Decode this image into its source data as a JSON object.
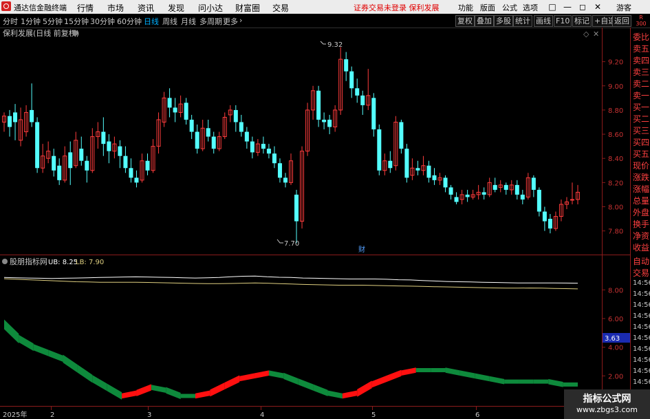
{
  "app": {
    "name": "通达信金融终端",
    "menu": [
      "行情",
      "市场",
      "资讯",
      "发现",
      "问小达",
      "财富圈",
      "交易"
    ],
    "notice": "证券交易未登录  保利发展",
    "right_menu": [
      "功能",
      "版面",
      "公式",
      "选项"
    ],
    "window_buttons": [
      "□",
      "—",
      "◻",
      "✕"
    ],
    "user": "游客"
  },
  "periods": [
    "分时",
    "1分钟",
    "5分钟",
    "15分钟",
    "30分钟",
    "60分钟",
    "日线",
    "周线",
    "月线",
    "多周期",
    "更多"
  ],
  "active_period": "日线",
  "toolbar_right": [
    "复权",
    "叠加",
    "多股",
    "统计",
    "画线",
    "F10",
    "标记",
    "+自选",
    "返回"
  ],
  "chart_title": "保利发展(日线 前复权)",
  "corner_badge": {
    "top": "R",
    "bottom": "300"
  },
  "price_axis": [
    "9.20",
    "9.00",
    "8.80",
    "8.60",
    "8.40",
    "8.20",
    "8.00",
    "7.80"
  ],
  "annotations": {
    "high": "9.32",
    "low": "7.70",
    "event": "财"
  },
  "indicator": {
    "name": "股朋指标网",
    "ub_label": "UB: 8.25",
    "lb_label": "LB: 7.90",
    "axis": [
      "8.00",
      "6.00",
      "4.00",
      "2.00"
    ],
    "current_value": "3.63"
  },
  "x_axis": [
    "2025年",
    "2",
    "3",
    "4",
    "5",
    "6"
  ],
  "side_panel": {
    "top_items": [
      "委比",
      "卖五",
      "卖四",
      "卖三",
      "卖二",
      "卖一",
      "买一",
      "买二",
      "买三",
      "买四",
      "买五",
      "现价",
      "涨跌",
      "涨幅",
      "总量",
      "外盘",
      "换手",
      "净资",
      "收益"
    ],
    "mid_items": [
      "自动",
      "交易"
    ],
    "times": [
      "14:56",
      "14:56",
      "14:56",
      "14:56",
      "14:56",
      "14:56",
      "14:56",
      "14:56",
      "14:56",
      "14:56",
      "14:56",
      "14:56",
      "14:56"
    ]
  },
  "watermark": {
    "line1": "指标公式网",
    "line2": "www.zbgs3.com"
  },
  "colors": {
    "up": "#ff3c3c",
    "down": "#54ffff",
    "ub": "#ffffff",
    "lb": "#e0d080",
    "osc_up": "#ff1010",
    "osc_down": "#0e8a3c"
  },
  "chart_data": {
    "type": "candlestick",
    "y_range": [
      7.65,
      9.38
    ],
    "candles": [
      [
        8.7,
        8.75,
        8.78,
        8.62
      ],
      [
        8.75,
        8.66,
        8.8,
        8.58
      ],
      [
        8.78,
        8.7,
        8.85,
        8.55
      ],
      [
        8.55,
        8.72,
        8.82,
        8.5
      ],
      [
        8.62,
        8.78,
        8.84,
        8.58
      ],
      [
        8.8,
        8.7,
        9.02,
        8.66
      ],
      [
        8.7,
        8.32,
        8.74,
        8.28
      ],
      [
        8.32,
        8.42,
        8.52,
        8.28
      ],
      [
        8.4,
        8.46,
        8.54,
        8.36
      ],
      [
        8.42,
        8.3,
        8.48,
        8.25
      ],
      [
        8.34,
        8.22,
        8.4,
        8.18
      ],
      [
        8.22,
        8.42,
        8.5,
        8.2
      ],
      [
        8.45,
        8.32,
        8.54,
        8.18
      ],
      [
        8.34,
        8.55,
        8.62,
        8.32
      ],
      [
        8.48,
        8.38,
        8.58,
        8.34
      ],
      [
        8.38,
        8.3,
        8.42,
        8.2
      ],
      [
        8.3,
        8.58,
        8.65,
        8.28
      ],
      [
        8.58,
        8.62,
        8.7,
        8.48
      ],
      [
        8.62,
        8.52,
        8.74,
        8.42
      ],
      [
        8.54,
        8.46,
        8.6,
        8.36
      ],
      [
        8.46,
        8.52,
        8.58,
        8.4
      ],
      [
        8.5,
        8.42,
        8.55,
        8.32
      ],
      [
        8.42,
        8.32,
        8.5,
        8.28
      ],
      [
        8.32,
        8.24,
        8.4,
        8.2
      ],
      [
        8.24,
        8.2,
        8.3,
        8.16
      ],
      [
        8.22,
        8.38,
        8.44,
        8.2
      ],
      [
        8.38,
        8.3,
        8.44,
        8.26
      ],
      [
        8.3,
        8.5,
        8.56,
        8.28
      ],
      [
        8.5,
        8.72,
        8.78,
        8.44
      ],
      [
        8.7,
        8.9,
        8.95,
        8.66
      ],
      [
        8.9,
        8.82,
        8.98,
        8.74
      ],
      [
        8.82,
        8.78,
        8.9,
        8.7
      ],
      [
        8.78,
        8.85,
        8.92,
        8.74
      ],
      [
        8.86,
        8.72,
        8.9,
        8.68
      ],
      [
        8.72,
        8.62,
        8.76,
        8.56
      ],
      [
        8.62,
        8.48,
        8.68,
        8.44
      ],
      [
        8.48,
        8.65,
        8.72,
        8.46
      ],
      [
        8.65,
        8.58,
        8.72,
        8.54
      ],
      [
        8.58,
        8.48,
        8.62,
        8.44
      ],
      [
        8.48,
        8.58,
        8.62,
        8.46
      ],
      [
        8.58,
        8.74,
        8.78,
        8.56
      ],
      [
        8.76,
        8.8,
        8.84,
        8.7
      ],
      [
        8.8,
        8.7,
        8.84,
        8.62
      ],
      [
        8.7,
        8.62,
        8.76,
        8.58
      ],
      [
        8.62,
        8.54,
        8.66,
        8.48
      ],
      [
        8.54,
        8.45,
        8.58,
        8.4
      ],
      [
        8.45,
        8.52,
        8.56,
        8.42
      ],
      [
        8.52,
        8.48,
        8.58,
        8.44
      ],
      [
        8.48,
        8.44,
        8.52,
        8.4
      ],
      [
        8.44,
        8.36,
        8.5,
        8.32
      ],
      [
        8.36,
        8.24,
        8.4,
        8.2
      ],
      [
        8.24,
        8.2,
        8.28,
        8.16
      ],
      [
        8.2,
        8.38,
        8.44,
        8.18
      ],
      [
        8.1,
        7.88,
        8.14,
        7.7
      ],
      [
        7.88,
        8.46,
        8.5,
        7.82
      ],
      [
        8.46,
        8.8,
        8.86,
        8.42
      ],
      [
        8.8,
        8.96,
        9.0,
        8.72
      ],
      [
        8.96,
        8.72,
        9.0,
        8.66
      ],
      [
        8.72,
        8.7,
        8.78,
        8.64
      ],
      [
        8.72,
        8.66,
        8.76,
        8.6
      ],
      [
        8.66,
        8.8,
        8.84,
        8.62
      ],
      [
        8.8,
        9.22,
        9.32,
        8.76
      ],
      [
        9.22,
        9.12,
        9.28,
        9.04
      ],
      [
        9.12,
        8.98,
        9.16,
        8.9
      ],
      [
        8.98,
        8.92,
        9.06,
        8.86
      ],
      [
        8.92,
        8.84,
        8.96,
        8.76
      ],
      [
        8.84,
        8.92,
        9.14,
        8.8
      ],
      [
        8.9,
        8.64,
        8.94,
        8.58
      ],
      [
        8.64,
        8.3,
        8.68,
        8.26
      ],
      [
        8.3,
        8.38,
        8.44,
        8.26
      ],
      [
        8.38,
        8.32,
        8.46,
        8.28
      ],
      [
        8.34,
        8.7,
        8.75,
        8.3
      ],
      [
        8.7,
        8.48,
        8.72,
        8.44
      ],
      [
        8.48,
        8.24,
        8.52,
        8.2
      ],
      [
        8.26,
        8.32,
        8.4,
        8.22
      ],
      [
        8.32,
        8.3,
        8.38,
        8.26
      ],
      [
        8.3,
        8.34,
        8.42,
        8.26
      ],
      [
        8.34,
        8.24,
        8.38,
        8.2
      ],
      [
        8.26,
        8.22,
        8.32,
        8.18
      ],
      [
        8.22,
        8.24,
        8.28,
        8.18
      ],
      [
        8.24,
        8.16,
        8.26,
        8.12
      ],
      [
        8.16,
        8.1,
        8.18,
        8.06
      ],
      [
        8.08,
        8.04,
        8.12,
        8.02
      ],
      [
        8.06,
        8.1,
        8.14,
        8.02
      ],
      [
        8.1,
        8.08,
        8.14,
        8.04
      ],
      [
        8.08,
        8.1,
        8.14,
        8.06
      ],
      [
        8.1,
        8.12,
        8.18,
        8.06
      ],
      [
        8.12,
        8.1,
        8.16,
        8.06
      ],
      [
        8.1,
        8.2,
        8.24,
        8.08
      ],
      [
        8.18,
        8.14,
        8.24,
        8.12
      ],
      [
        8.16,
        8.18,
        8.22,
        8.12
      ],
      [
        8.18,
        8.14,
        8.2,
        8.1
      ],
      [
        8.14,
        8.18,
        8.22,
        8.1
      ],
      [
        8.18,
        8.1,
        8.22,
        8.06
      ],
      [
        8.1,
        8.06,
        8.14,
        8.02
      ],
      [
        8.08,
        8.24,
        8.28,
        8.06
      ],
      [
        8.24,
        8.14,
        8.26,
        8.08
      ],
      [
        8.14,
        7.96,
        8.16,
        7.92
      ],
      [
        7.96,
        7.88,
        8.0,
        7.8
      ],
      [
        7.9,
        7.82,
        7.94,
        7.78
      ],
      [
        7.82,
        7.92,
        7.96,
        7.8
      ],
      [
        7.92,
        8.02,
        8.06,
        7.88
      ],
      [
        8.02,
        8.04,
        8.08,
        7.98
      ],
      [
        8.06,
        8.06,
        8.2,
        8.02
      ],
      [
        8.06,
        8.12,
        8.18,
        8.02
      ]
    ],
    "ub": [
      8.9,
      8.88,
      8.86,
      8.84,
      8.82,
      8.84,
      8.86,
      8.88,
      8.9,
      8.92,
      8.94,
      8.95,
      8.94,
      8.92,
      8.9,
      8.88,
      8.86,
      8.88,
      8.9,
      8.96,
      9.0,
      9.02,
      8.96,
      8.92,
      8.9,
      8.86,
      8.84,
      8.82,
      8.8,
      8.78,
      8.78,
      8.78,
      8.76,
      8.72,
      8.7,
      8.66,
      8.62,
      8.58,
      8.56,
      8.54,
      8.52,
      8.5,
      8.48,
      8.46,
      8.46,
      8.46,
      8.46,
      8.45,
      8.44
    ],
    "lb": [
      8.8,
      8.76,
      8.72,
      8.68,
      8.64,
      8.6,
      8.56,
      8.54,
      8.52,
      8.52,
      8.52,
      8.52,
      8.5,
      8.48,
      8.46,
      8.44,
      8.42,
      8.4,
      8.4,
      8.42,
      8.44,
      8.46,
      8.44,
      8.4,
      8.38,
      8.34,
      8.32,
      8.3,
      8.28,
      8.28,
      8.28,
      8.26,
      8.24,
      8.22,
      8.2,
      8.18,
      8.16,
      8.14,
      8.12,
      8.1,
      8.08,
      8.06,
      8.04,
      8.04,
      8.05,
      8.04,
      8.02,
      8.0,
      7.98
    ],
    "osc": [
      5.6,
      4.6,
      4.0,
      3.6,
      3.2,
      2.5,
      1.8,
      1.2,
      0.6,
      0.8,
      1.2,
      1.0,
      0.6,
      0.6,
      0.8,
      1.3,
      1.8,
      2.0,
      2.2,
      2.0,
      1.6,
      1.2,
      0.8,
      0.6,
      0.8,
      1.4,
      1.8,
      2.2,
      2.4,
      2.4,
      2.4,
      2.2,
      2.0,
      1.8,
      1.6,
      1.6,
      1.6,
      1.6,
      1.4,
      1.4
    ]
  }
}
